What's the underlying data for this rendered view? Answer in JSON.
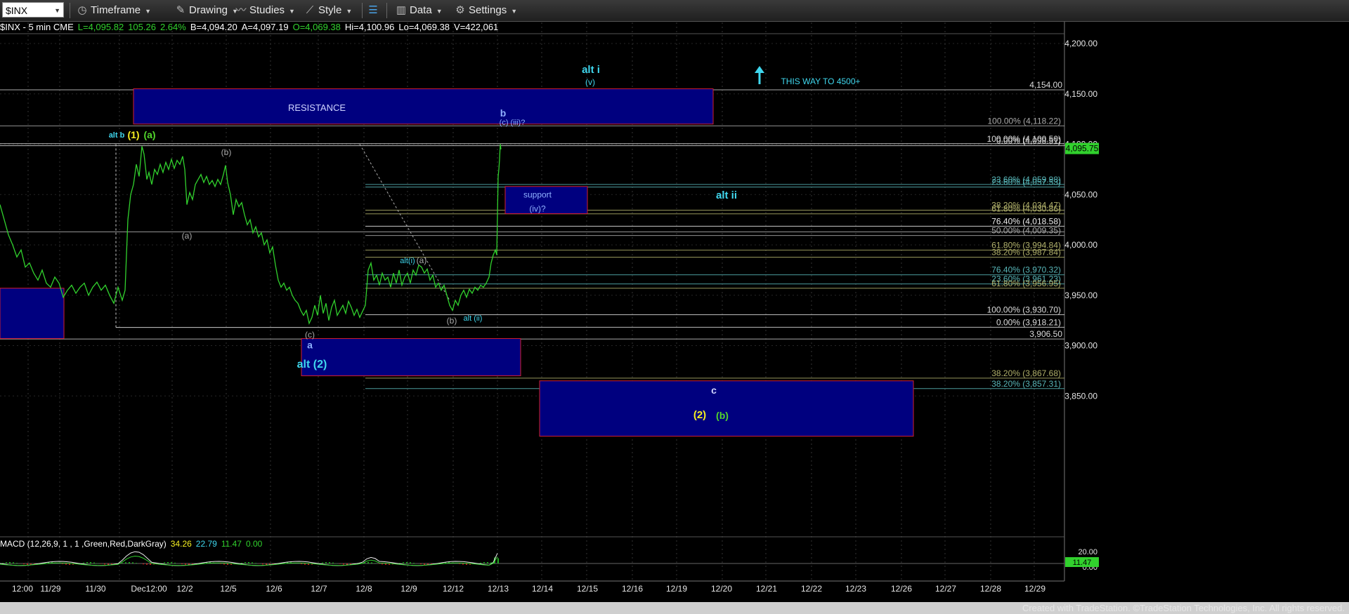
{
  "toolbar": {
    "symbol": "$INX",
    "timeframe": "Timeframe",
    "drawing": "Drawing",
    "studies": "Studies",
    "style": "Style",
    "data": "Data",
    "settings": "Settings"
  },
  "info": {
    "symbol": "$INX - 5 min  CME",
    "last": "L=4,095.82",
    "change": "105.26",
    "pct": "2.64%",
    "bid": "B=4,094.20",
    "ask": "A=4,097.19",
    "open": "O=4,069.38",
    "high": "Hi=4,100.96",
    "low": "Lo=4,069.38",
    "volume": "V=422,061"
  },
  "macd": {
    "title": "MACD (12,26,9, 1 , 1 ,Green,Red,DarkGray)",
    "v1": "34.26",
    "v2": "22.79",
    "v3": "11.47",
    "v4": "0.00",
    "axis_labels": [
      "20.00",
      "0.00"
    ],
    "last_tag": "11.47"
  },
  "footer": "Created with TradeStation. ©TradeStation Technologies, Inc. All rights reserved.",
  "colors": {
    "price": "#31d12d",
    "zone_fill": "#00007f",
    "zone_border": "#d41f2f",
    "cyan_label": "#3fd7ee",
    "yellow_label": "#f4ef21",
    "green_label": "#52d62c",
    "fib_olive": "#b0b06a",
    "fib_teal": "#58b6b8"
  },
  "chart_data": {
    "type": "line",
    "series": [
      {
        "values": [
          [
            0,
            4040
          ],
          [
            6,
            4025
          ],
          [
            12,
            4010
          ],
          [
            18,
            4000
          ],
          [
            24,
            3988
          ],
          [
            30,
            3995
          ],
          [
            36,
            3978
          ],
          [
            42,
            3982
          ],
          [
            48,
            3972
          ],
          [
            54,
            3965
          ],
          [
            60,
            3975
          ],
          [
            66,
            3962
          ],
          [
            72,
            3958
          ],
          [
            78,
            3968
          ],
          [
            84,
            3962
          ],
          [
            90,
            3948
          ],
          [
            96,
            3955
          ],
          [
            102,
            3960
          ],
          [
            108,
            3952
          ],
          [
            114,
            3958
          ],
          [
            120,
            3962
          ],
          [
            126,
            3950
          ],
          [
            132,
            3958
          ],
          [
            138,
            3963
          ],
          [
            144,
            3955
          ],
          [
            150,
            3960
          ],
          [
            156,
            3950
          ],
          [
            162,
            3942
          ],
          [
            168,
            3958
          ],
          [
            174,
            3945
          ],
          [
            178,
            3955
          ],
          [
            182,
            4025
          ],
          [
            186,
            4050
          ],
          [
            190,
            4060
          ],
          [
            194,
            4080
          ],
          [
            198,
            4068
          ],
          [
            202,
            4098
          ],
          [
            205,
            4090
          ],
          [
            209,
            4065
          ],
          [
            212,
            4072
          ],
          [
            216,
            4060
          ],
          [
            220,
            4075
          ],
          [
            224,
            4070
          ],
          [
            228,
            4080
          ],
          [
            232,
            4072
          ],
          [
            236,
            4082
          ],
          [
            240,
            4075
          ],
          [
            244,
            4085
          ],
          [
            248,
            4076
          ],
          [
            252,
            4084
          ],
          [
            256,
            4080
          ],
          [
            260,
            4088
          ],
          [
            263,
            4075
          ],
          [
            266,
            4040
          ],
          [
            270,
            4052
          ],
          [
            274,
            4045
          ],
          [
            278,
            4060
          ],
          [
            282,
            4065
          ],
          [
            286,
            4070
          ],
          [
            290,
            4062
          ],
          [
            294,
            4068
          ],
          [
            298,
            4060
          ],
          [
            302,
            4064
          ],
          [
            306,
            4058
          ],
          [
            310,
            4065
          ],
          [
            314,
            4060
          ],
          [
            318,
            4070
          ],
          [
            321,
            4079
          ],
          [
            324,
            4062
          ],
          [
            328,
            4050
          ],
          [
            332,
            4030
          ],
          [
            336,
            4045
          ],
          [
            340,
            4038
          ],
          [
            344,
            4042
          ],
          [
            348,
            4030
          ],
          [
            352,
            4020
          ],
          [
            356,
            4025
          ],
          [
            360,
            4012
          ],
          [
            364,
            4018
          ],
          [
            368,
            4008
          ],
          [
            372,
            4012
          ],
          [
            376,
            4000
          ],
          [
            380,
            4005
          ],
          [
            384,
            3992
          ],
          [
            388,
            3998
          ],
          [
            392,
            3980
          ],
          [
            396,
            3965
          ],
          [
            400,
            3958
          ],
          [
            404,
            3962
          ],
          [
            408,
            3955
          ],
          [
            412,
            3958
          ],
          [
            416,
            3950
          ],
          [
            420,
            3945
          ],
          [
            424,
            3942
          ],
          [
            428,
            3935
          ],
          [
            432,
            3930
          ],
          [
            436,
            3935
          ],
          [
            440,
            3922
          ],
          [
            444,
            3928
          ],
          [
            448,
            3940
          ],
          [
            452,
            3930
          ],
          [
            456,
            3950
          ],
          [
            460,
            3932
          ],
          [
            464,
            3942
          ],
          [
            468,
            3925
          ],
          [
            472,
            3938
          ],
          [
            476,
            3945
          ],
          [
            480,
            3930
          ],
          [
            484,
            3935
          ],
          [
            488,
            3940
          ],
          [
            492,
            3932
          ],
          [
            496,
            3944
          ],
          [
            500,
            3938
          ],
          [
            504,
            3930
          ],
          [
            508,
            3936
          ],
          [
            512,
            3928
          ],
          [
            516,
            3934
          ],
          [
            520,
            3940
          ],
          [
            524,
            3975
          ],
          [
            528,
            3982
          ],
          [
            532,
            3965
          ],
          [
            536,
            3970
          ],
          [
            540,
            3960
          ],
          [
            544,
            3972
          ],
          [
            548,
            3965
          ],
          [
            552,
            3968
          ],
          [
            556,
            3958
          ],
          [
            560,
            3972
          ],
          [
            564,
            3962
          ],
          [
            568,
            3975
          ],
          [
            572,
            3960
          ],
          [
            576,
            3968
          ],
          [
            580,
            3972
          ],
          [
            584,
            3962
          ],
          [
            588,
            3975
          ],
          [
            592,
            3970
          ],
          [
            596,
            3980
          ],
          [
            600,
            3978
          ],
          [
            604,
            3972
          ],
          [
            608,
            3976
          ],
          [
            612,
            3965
          ],
          [
            616,
            3970
          ],
          [
            620,
            3958
          ],
          [
            624,
            3962
          ],
          [
            628,
            3955
          ],
          [
            632,
            3960
          ],
          [
            636,
            3950
          ],
          [
            640,
            3940
          ],
          [
            644,
            3935
          ],
          [
            648,
            3945
          ],
          [
            652,
            3940
          ],
          [
            656,
            3950
          ],
          [
            660,
            3955
          ],
          [
            664,
            3948
          ],
          [
            668,
            3956
          ],
          [
            672,
            3952
          ],
          [
            676,
            3958
          ],
          [
            680,
            3955
          ],
          [
            684,
            3960
          ],
          [
            688,
            3958
          ],
          [
            692,
            3962
          ],
          [
            696,
            3968
          ],
          [
            699,
            3982
          ],
          [
            702,
            3990
          ],
          [
            705,
            3995
          ],
          [
            707,
            3990
          ],
          [
            709,
            4068
          ],
          [
            710,
            4075
          ],
          [
            711,
            4085
          ],
          [
            712,
            4100
          ],
          [
            713,
            4095
          ]
        ]
      }
    ],
    "x_labels": [
      "12:00",
      "11/29",
      "11/30",
      "Dec12:00",
      "12/2",
      "12/5",
      "12/6",
      "12/7",
      "12/8",
      "12/9",
      "12/12",
      "12/13",
      "12/14",
      "12/15",
      "12/16",
      "12/19",
      "12/20",
      "12/21",
      "12/22",
      "12/23",
      "12/26",
      "12/27",
      "12/28",
      "12/29"
    ],
    "y_ticks": [
      3850,
      3900,
      3950,
      4000,
      4050,
      4100,
      4150,
      4200
    ],
    "y_tick_labels": [
      "3,850.00",
      "3,900.00",
      "3,950.00",
      "4,000.00",
      "4,050.00",
      "4,100.00",
      "4,150.00",
      "4,200.00"
    ],
    "ylim": [
      3810,
      4230
    ],
    "last_price_tag": "4,095.75",
    "price_tags": [
      {
        "value": 4154.0,
        "label": "4,154.00"
      },
      {
        "value": 3906.5,
        "label": "3,906.50"
      }
    ],
    "fib_levels": [
      {
        "value": 4118.22,
        "label": "100.00% (4,118.22)",
        "color": "#aaaaaa"
      },
      {
        "value": 4100.5,
        "label": "100.00% (4,100.50)",
        "color": "#dddddd"
      },
      {
        "value": 4098.5,
        "label": "0.00% (4,098.51)",
        "color": "#dddddd"
      },
      {
        "value": 4060.0,
        "label": "23.60% (4,059.98)",
        "color": "#58b6b8"
      },
      {
        "value": 4057.5,
        "label": "23.60% (4,057.53)",
        "color": "#58b6b8"
      },
      {
        "value": 4034.47,
        "label": "38.20% (4,034.47)",
        "color": "#b0b06a"
      },
      {
        "value": 4030.86,
        "label": "61.80% (4,030.86)",
        "color": "#b0b06a"
      },
      {
        "value": 4018.58,
        "label": "76.40% (4,018.58)",
        "color": "#eeeeee"
      },
      {
        "value": 4009.35,
        "label": "50.00% (4,009.35)",
        "color": "#aaaaaa"
      },
      {
        "value": 3994.84,
        "label": "61.80% (3,994.84)",
        "color": "#b0b06a"
      },
      {
        "value": 3987.84,
        "label": "38.20% (3,987.84)",
        "color": "#b0b06a"
      },
      {
        "value": 3970.32,
        "label": "76.40% (3,970.32)",
        "color": "#58b6b8"
      },
      {
        "value": 3961.23,
        "label": "23.60% (3,961.23)",
        "color": "#58b6b8"
      },
      {
        "value": 3956.95,
        "label": "61.80% (3,956.95)",
        "color": "#b0b06a"
      },
      {
        "value": 3930.7,
        "label": "100.00% (3,930.70)",
        "color": "#dddddd"
      },
      {
        "value": 3918.21,
        "label": "0.00% (3,918.21)",
        "color": "#dddddd"
      },
      {
        "value": 3867.68,
        "label": "38.20% (3,867.68)",
        "color": "#b0b06a"
      },
      {
        "value": 3857.31,
        "label": "38.20% (3,857.31)",
        "color": "#58b6b8"
      }
    ],
    "zones": [
      {
        "name": "resistance",
        "label": "RESISTANCE",
        "y_top": 4155,
        "y_bottom": 4120
      },
      {
        "name": "support",
        "label": "support",
        "sub": "(iv)?",
        "y_top": 4058,
        "y_bottom": 4031
      },
      {
        "name": "alt2",
        "label": "a",
        "sub": "alt (2)",
        "y_top": 3907,
        "y_bottom": 3870
      },
      {
        "name": "left",
        "label": "",
        "y_top": 3957,
        "y_bottom": 3907
      },
      {
        "name": "wave-c",
        "label": "c",
        "y_top": 3865,
        "y_bottom": 3810
      }
    ],
    "annotations": [
      {
        "text": "alt i",
        "color": "#3fd7ee"
      },
      {
        "text": "(v)",
        "color": "#3fd7ee"
      },
      {
        "text": "THIS WAY TO 4500+",
        "color": "#3fd7ee"
      },
      {
        "text": "b",
        "color": "#8fb0ff"
      },
      {
        "text": "(c) (iii)?",
        "color": "#8fb0ff"
      },
      {
        "text": "alt b",
        "color": "#3fd7ee"
      },
      {
        "text": "(1)",
        "color": "#f4ef21"
      },
      {
        "text": "(a)",
        "color": "#52d62c"
      },
      {
        "text": "(b)",
        "color": "#aaaaaa"
      },
      {
        "text": "(a)",
        "color": "#aaaaaa"
      },
      {
        "text": "alt ii",
        "color": "#3fd7ee"
      },
      {
        "text": "alt(i)",
        "color": "#3fd7ee"
      },
      {
        "text": "(a)",
        "color": "#aaaaaa"
      },
      {
        "text": "(b)",
        "color": "#aaaaaa"
      },
      {
        "text": "alt (ii)",
        "color": "#3fd7ee"
      },
      {
        "text": "(c)",
        "color": "#aaaaaa"
      },
      {
        "text": "(2)",
        "color": "#f4ef21"
      },
      {
        "text": "(b)",
        "color": "#52d62c"
      }
    ]
  }
}
